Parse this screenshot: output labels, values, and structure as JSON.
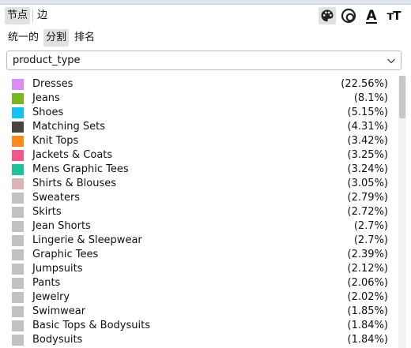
{
  "tabs": [
    {
      "label": "节点",
      "active": true
    },
    {
      "label": "边",
      "active": false
    }
  ],
  "toolbar": {
    "icons": [
      "palette-icon",
      "size-icon",
      "font-color-icon",
      "font-size-icon"
    ],
    "font_color_glyph": "A",
    "font_size_glyph": "ᴛT"
  },
  "subtabs": [
    {
      "label": "统一的",
      "active": false
    },
    {
      "label": "分割",
      "active": true
    },
    {
      "label": "排名",
      "active": false
    }
  ],
  "attribute_select": {
    "value": "product_type"
  },
  "legend_items": [
    {
      "label": "Dresses",
      "percent": "(22.56%)",
      "color": "#dd8bf5"
    },
    {
      "label": "Jeans",
      "percent": "(8.1%)",
      "color": "#78b81e"
    },
    {
      "label": "Shoes",
      "percent": "(5.15%)",
      "color": "#13c1f4"
    },
    {
      "label": "Matching Sets",
      "percent": "(4.31%)",
      "color": "#4b433f"
    },
    {
      "label": "Knit Tops",
      "percent": "(3.42%)",
      "color": "#fb8b17"
    },
    {
      "label": "Jackets & Coats",
      "percent": "(3.25%)",
      "color": "#f5578a"
    },
    {
      "label": "Mens Graphic Tees",
      "percent": "(3.24%)",
      "color": "#1fc29a"
    },
    {
      "label": "Shirts & Blouses",
      "percent": "(3.05%)",
      "color": "#dcb4b4"
    },
    {
      "label": "Sweaters",
      "percent": "(2.79%)",
      "color": "#c2c2c2"
    },
    {
      "label": "Skirts",
      "percent": "(2.72%)",
      "color": "#c2c2c2"
    },
    {
      "label": "Jean Shorts",
      "percent": "(2.7%)",
      "color": "#c2c2c2"
    },
    {
      "label": "Lingerie & Sleepwear",
      "percent": "(2.7%)",
      "color": "#c2c2c2"
    },
    {
      "label": "Graphic Tees",
      "percent": "(2.39%)",
      "color": "#c2c2c2"
    },
    {
      "label": "Jumpsuits",
      "percent": "(2.12%)",
      "color": "#c2c2c2"
    },
    {
      "label": "Pants",
      "percent": "(2.06%)",
      "color": "#c2c2c2"
    },
    {
      "label": "Jewelry",
      "percent": "(2.02%)",
      "color": "#c2c2c2"
    },
    {
      "label": "Swimwear",
      "percent": "(1.85%)",
      "color": "#c2c2c2"
    },
    {
      "label": "Basic Tops & Bodysuits",
      "percent": "(1.84%)",
      "color": "#c2c2c2"
    },
    {
      "label": "Bodysuits",
      "percent": "(1.84%)",
      "color": "#c2c2c2"
    }
  ]
}
